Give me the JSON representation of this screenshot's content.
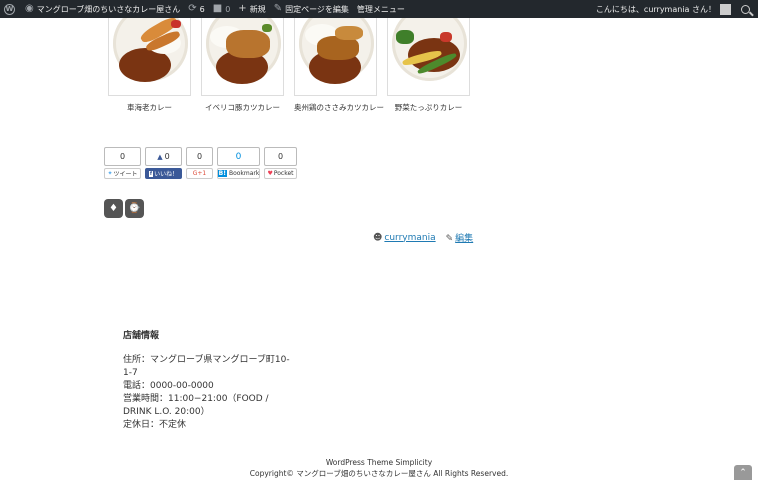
{
  "adminbar": {
    "site_name": "マングローブ畑のちいさなカレー屋さん",
    "updates": "6",
    "comments": "0",
    "new_label": "新規",
    "edit_label": "固定ページを編集",
    "admin_menu": "管理メニュー",
    "greeting": "こんにちは、currymania さん！"
  },
  "thumbnails": [
    {
      "caption": "車海老カレー"
    },
    {
      "caption": "イベリコ豚カツカレー"
    },
    {
      "caption": "奥州鶏のささみカツカレー"
    },
    {
      "caption": "野菜たっぷりカレー"
    }
  ],
  "share": {
    "twitter": {
      "count": "0",
      "label": "ツイート"
    },
    "facebook": {
      "count": "0",
      "label": "いいね！"
    },
    "gplus": {
      "count": "0",
      "label": "G+1"
    },
    "hatena": {
      "count": "0",
      "label": "Bookmark"
    },
    "pocket": {
      "count": "0",
      "label": "Pocket"
    }
  },
  "author": {
    "name": "currymania",
    "edit": "編集"
  },
  "store": {
    "title": "店舗情報",
    "address": "住所：マングローブ県マングローブ町10-1-7",
    "phone": "電話：0000-00-0000",
    "hours": "営業時間：11:00−21:00（FOOD / DRINK L.O. 20:00）",
    "holiday": "定休日：不定休"
  },
  "footer": {
    "theme": "WordPress Theme Simplicity",
    "copyright": "Copyright© マングローブ畑のちいさなカレー屋さん All Rights Reserved."
  },
  "colors": {
    "adminbar": "#23282d",
    "link": "#1f7ab3",
    "facebook": "#3b5998",
    "hatena": "#008fde",
    "pocket": "#ee4056"
  }
}
